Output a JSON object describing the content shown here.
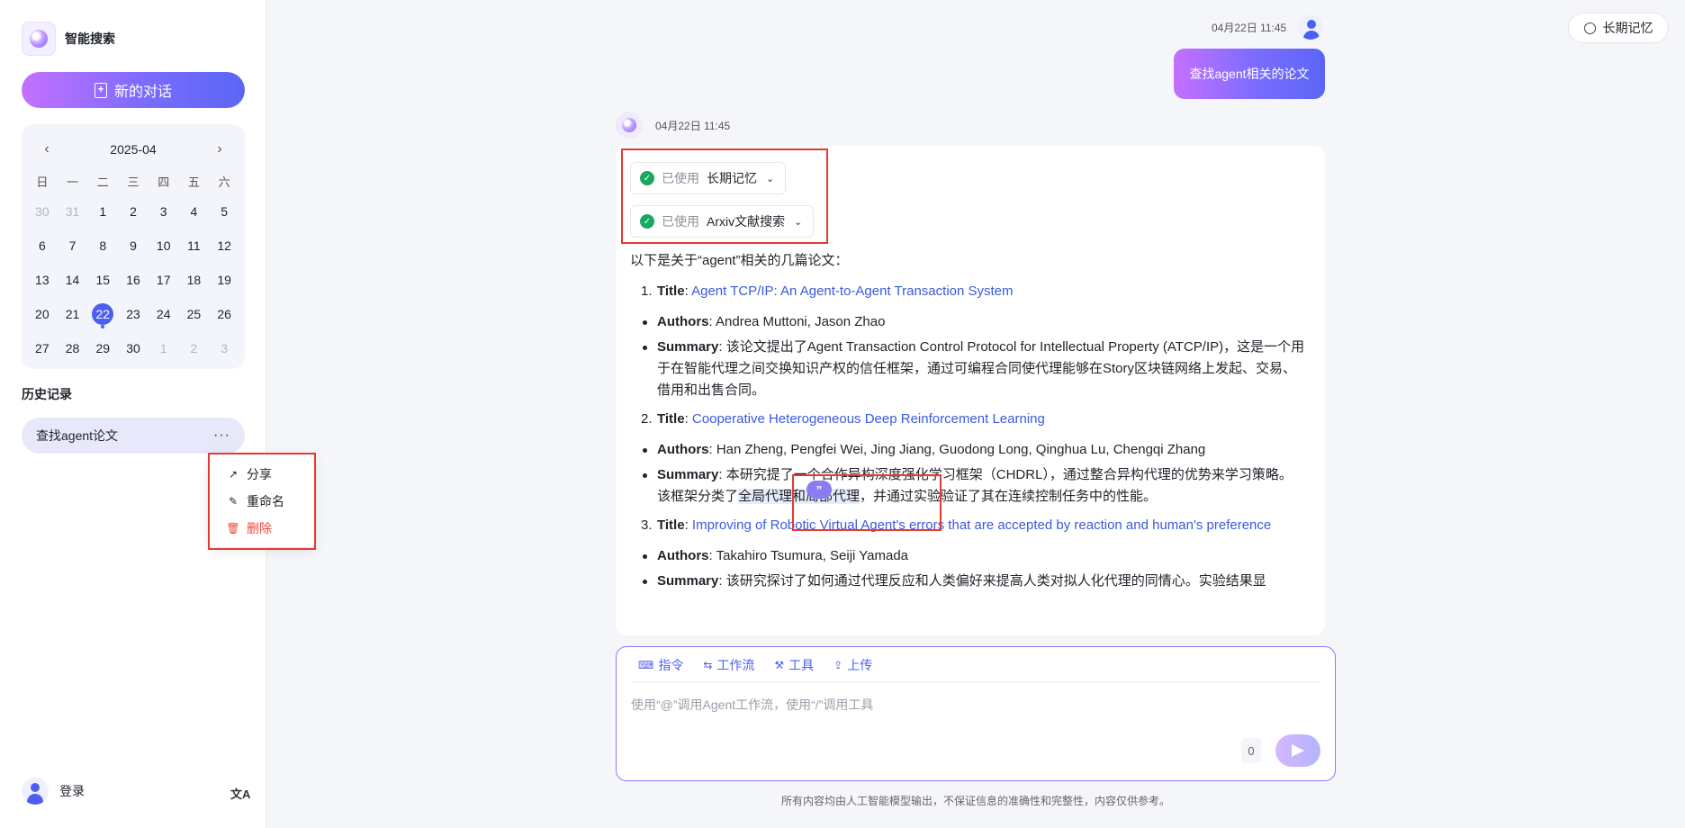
{
  "app": {
    "name": "智能搜索"
  },
  "sidebar": {
    "new_chat_label": "新的对话",
    "calendar": {
      "title": "2025-04",
      "weekdays": [
        "日",
        "一",
        "二",
        "三",
        "四",
        "五",
        "六"
      ],
      "days": [
        [
          "30",
          "31",
          "1",
          "2",
          "3",
          "4",
          "5"
        ],
        [
          "6",
          "7",
          "8",
          "9",
          "10",
          "11",
          "12"
        ],
        [
          "13",
          "14",
          "15",
          "16",
          "17",
          "18",
          "19"
        ],
        [
          "20",
          "21",
          "22",
          "23",
          "24",
          "25",
          "26"
        ],
        [
          "27",
          "28",
          "29",
          "30",
          "1",
          "2",
          "3"
        ]
      ],
      "selected": "22"
    },
    "history_title": "历史记录",
    "history_items": [
      "查找agent论文"
    ],
    "context_menu": {
      "share": "分享",
      "rename": "重命名",
      "delete": "删除"
    },
    "login_label": "登录",
    "lang_icon": "translate-icon"
  },
  "header": {
    "memory_button": "长期记忆"
  },
  "chat": {
    "user": {
      "time": "04月22日 11:45",
      "message": "查找agent相关的论文"
    },
    "bot": {
      "time": "04月22日 11:45",
      "tools": [
        {
          "status": "已使用",
          "name": "长期记忆"
        },
        {
          "status": "已使用",
          "name": "Arxiv文献搜索"
        }
      ],
      "intro": "以下是关于“agent”相关的几篇论文：",
      "labels": {
        "title": "Title",
        "authors": "Authors",
        "summary": "Summary"
      },
      "papers": [
        {
          "num": "1.",
          "title": "Agent TCP/IP: An Agent-to-Agent Transaction System",
          "authors": "Andrea Muttoni, Jason Zhao",
          "summary": "该论文提出了Agent Transaction Control Protocol for Intellectual Property (ATCP/IP)，这是一个用于在智能代理之间交换知识产权的信任框架，通过可编程合同使代理能够在Story区块链网络上发起、交易、借用和出售合同。"
        },
        {
          "num": "2.",
          "title": "Cooperative Heterogeneous Deep Reinforcement Learning",
          "authors": "Han Zheng, Pengfei Wei, Jing Jiang, Guodong Long, Qinghua Lu, Chengqi Zhang",
          "summary_a": "本研究提",
          "summary_b": "了一个合作异构深度强化学习框架（CHDRL），通过整合异构代理的优势来学习策略。该框架分类了",
          "summary_hl": "全局代理和局部代理",
          "summary_c": "，并通过实验验证了其在连续控制任务中的性能。"
        },
        {
          "num": "3.",
          "title": "Improving of Robotic Virtual Agent's errors that are accepted by reaction and human's preference",
          "authors": "Takahiro Tsumura, Seiji Yamada",
          "summary": "该研究探讨了如何通过代理反应和人类偏好来提高人类对拟人化代理的同情心。实验结果显"
        }
      ]
    }
  },
  "input": {
    "tools": [
      "指令",
      "工作流",
      "工具",
      "上传"
    ],
    "placeholder": "使用“@”调用Agent工作流，使用“/”调用工具",
    "char_count": "0"
  },
  "footer": {
    "disclaimer": "所有内容均由人工智能模型输出，不保证信息的准确性和完整性，内容仅供参考。"
  }
}
